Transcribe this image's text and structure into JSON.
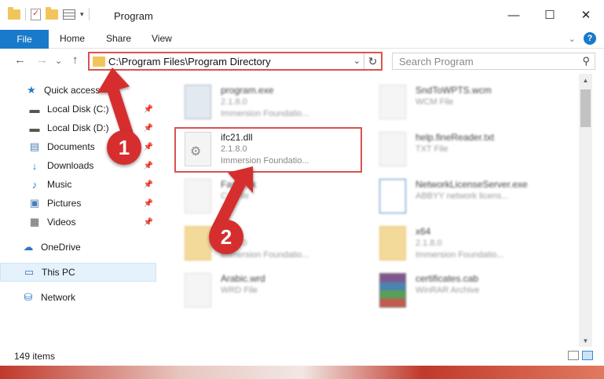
{
  "titlebar": {
    "title": "Program",
    "minimize_glyph": "—",
    "maximize_glyph": "☐",
    "close_glyph": "✕"
  },
  "ribbon": {
    "tabs": [
      "File",
      "Home",
      "Share",
      "View"
    ],
    "help_glyph": "?",
    "expand_glyph": "⌄"
  },
  "nav": {
    "back_glyph": "←",
    "forward_glyph": "→",
    "recent_glyph": "⌄",
    "up_glyph": "↑",
    "address_path": "C:\\Program Files\\Program Directory",
    "address_dropdown_glyph": "⌄",
    "refresh_glyph": "↻",
    "search_placeholder": "Search Program",
    "search_glyph": "⚲"
  },
  "sidebar": {
    "items": [
      {
        "label": "Quick access",
        "icon": "star-icon",
        "glyph": "★",
        "color": "#2b78c6",
        "pinned": false
      },
      {
        "label": "Local Disk (C:)",
        "icon": "drive-icon",
        "glyph": "▬",
        "color": "#555555",
        "pinned": true
      },
      {
        "label": "Local Disk (D:)",
        "icon": "drive-icon",
        "glyph": "▬",
        "color": "#555555",
        "pinned": true
      },
      {
        "label": "Documents",
        "icon": "documents-icon",
        "glyph": "▤",
        "color": "#4a7db8",
        "pinned": true
      },
      {
        "label": "Downloads",
        "icon": "downloads-icon",
        "glyph": "↓",
        "color": "#2b78c6",
        "pinned": true
      },
      {
        "label": "Music",
        "icon": "music-icon",
        "glyph": "♪",
        "color": "#2b78c6",
        "pinned": true
      },
      {
        "label": "Pictures",
        "icon": "pictures-icon",
        "glyph": "▣",
        "color": "#4a7db8",
        "pinned": true
      },
      {
        "label": "Videos",
        "icon": "videos-icon",
        "glyph": "▦",
        "color": "#555555",
        "pinned": true
      },
      {
        "label": "OneDrive",
        "icon": "onedrive-icon",
        "glyph": "☁",
        "color": "#2b78c6",
        "pinned": false
      },
      {
        "label": "This PC",
        "icon": "computer-icon",
        "glyph": "▭",
        "color": "#2b78c6",
        "pinned": false
      },
      {
        "label": "Network",
        "icon": "network-icon",
        "glyph": "⛁",
        "color": "#2b78c6",
        "pinned": false
      }
    ],
    "pin_glyph": "📌"
  },
  "files": {
    "highlighted": {
      "name": "ifc21.dll",
      "version": "2.1.8.0",
      "desc": "Immersion Foundatio..."
    },
    "left": [
      {
        "name": "program.exe",
        "line2": "2.1.8.0",
        "line3": "Immersion Foundatio...",
        "kind": "app"
      },
      {
        "name": "Fast...ck",
        "line2": "CK File",
        "line3": "",
        "kind": "doc"
      },
      {
        "name": "",
        "line2": "2.1.8.0",
        "line3": "Immersion Foundatio...",
        "kind": "folder"
      },
      {
        "name": "Arabic.wrd",
        "line2": "WRD File",
        "line3": "",
        "kind": "doc"
      }
    ],
    "right": [
      {
        "name": "SndToWPTS.wcm",
        "line2": "WCM File",
        "line3": "",
        "kind": "doc"
      },
      {
        "name": "help.fineReader.txt",
        "line2": "TXT File",
        "line3": "",
        "kind": "doc"
      },
      {
        "name": "NetworkLicenseServer.exe",
        "line2": "ABBYY network licens...",
        "line3": "",
        "kind": "net"
      },
      {
        "name": "x64",
        "line2": "2.1.8.0",
        "line3": "Immersion Foundatio...",
        "kind": "folder"
      },
      {
        "name": "certificates.cab",
        "line2": "WinRAR Archive",
        "line3": "",
        "kind": "archive"
      }
    ]
  },
  "status": {
    "item_count": "149 items"
  },
  "annotations": {
    "badge1": "1",
    "badge2": "2",
    "color": "#d62e2e"
  }
}
